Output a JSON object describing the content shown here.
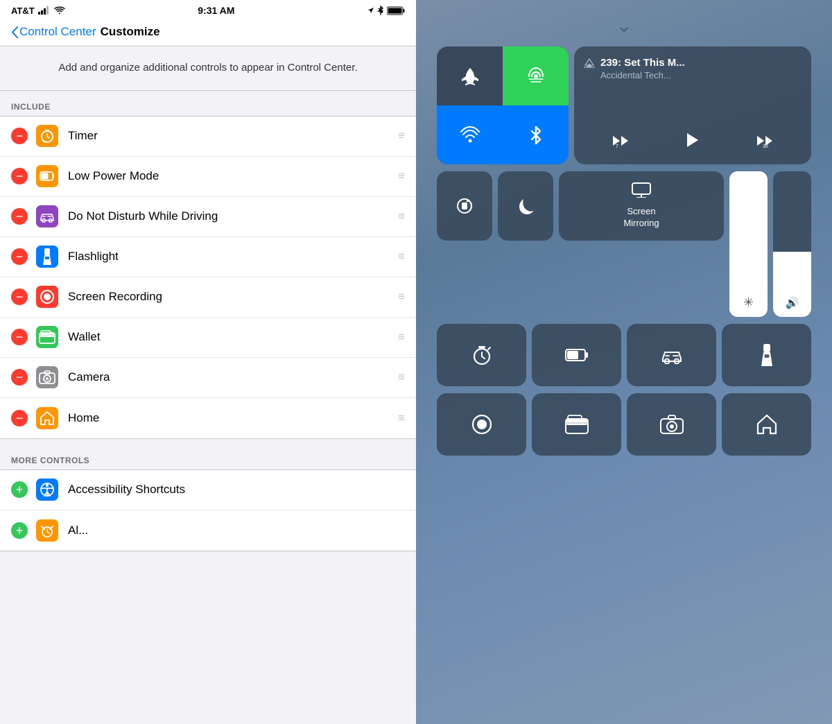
{
  "statusBar": {
    "carrier": "AT&T",
    "time": "9:31 AM",
    "battery": "100"
  },
  "nav": {
    "backLabel": "Control Center",
    "title": "Customize"
  },
  "description": "Add and organize additional controls to appear in Control Center.",
  "includeSectionHeader": "INCLUDE",
  "includeItems": [
    {
      "id": "timer",
      "label": "Timer",
      "iconBg": "#ff9500",
      "iconType": "timer"
    },
    {
      "id": "low-power",
      "label": "Low Power Mode",
      "iconBg": "#ff9500",
      "iconType": "battery"
    },
    {
      "id": "dnd-driving",
      "label": "Do Not Disturb While Driving",
      "iconBg": "#8e45bf",
      "iconType": "car"
    },
    {
      "id": "flashlight",
      "label": "Flashlight",
      "iconBg": "#007aff",
      "iconType": "flashlight"
    },
    {
      "id": "screen-recording",
      "label": "Screen Recording",
      "iconBg": "#ff3b30",
      "iconType": "record"
    },
    {
      "id": "wallet",
      "label": "Wallet",
      "iconBg": "#34c759",
      "iconType": "wallet"
    },
    {
      "id": "camera",
      "label": "Camera",
      "iconBg": "#8e8e93",
      "iconType": "camera"
    },
    {
      "id": "home",
      "label": "Home",
      "iconBg": "#ff9500",
      "iconType": "home"
    }
  ],
  "moreControlsHeader": "MORE CONTROLS",
  "moreItems": [
    {
      "id": "accessibility",
      "label": "Accessibility Shortcuts",
      "iconBg": "#007aff",
      "iconType": "accessibility"
    },
    {
      "id": "alarm",
      "label": "Al...",
      "iconBg": "#ff9500",
      "iconType": "alarm"
    }
  ],
  "controlCenter": {
    "nowPlaying": {
      "title": "239: Set This M...",
      "subtitle": "Accidental Tech..."
    },
    "screenMirroring": "Screen\nMirroring"
  }
}
